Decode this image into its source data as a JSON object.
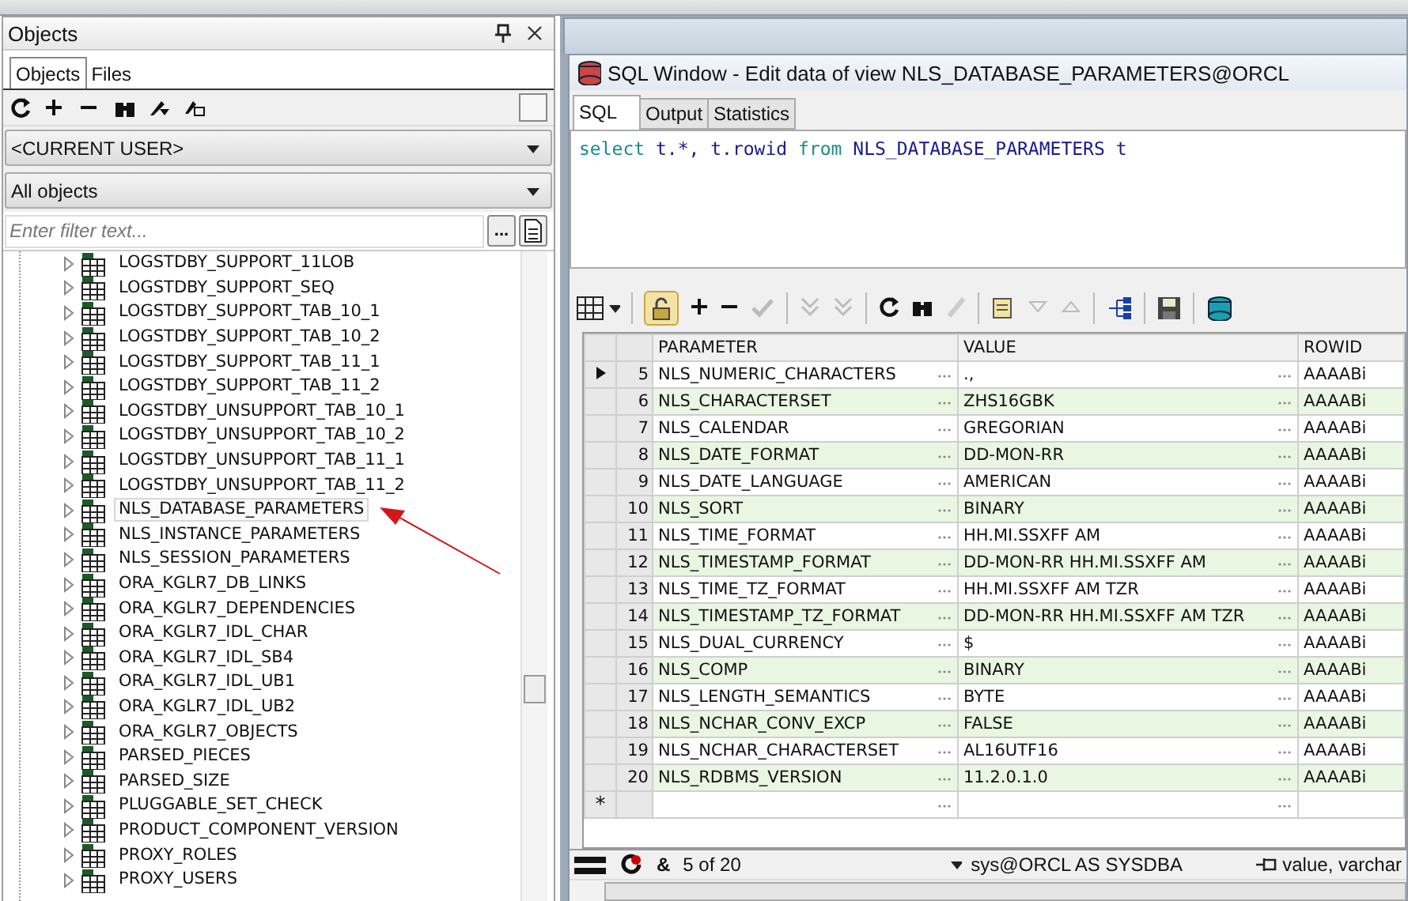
{
  "objects_panel": {
    "title": "Objects",
    "tabs": [
      {
        "label": "Objects",
        "selected": true
      },
      {
        "label": "Files",
        "selected": false
      }
    ],
    "owner_select": {
      "value": "<CURRENT USER>"
    },
    "type_select": {
      "value": "All objects"
    },
    "filter": {
      "placeholder": "Enter filter text...",
      "button": "..."
    },
    "tree": [
      {
        "label": "LOGSTDBY_SUPPORT_11LOB",
        "selected": false
      },
      {
        "label": "LOGSTDBY_SUPPORT_SEQ",
        "selected": false
      },
      {
        "label": "LOGSTDBY_SUPPORT_TAB_10_1",
        "selected": false
      },
      {
        "label": "LOGSTDBY_SUPPORT_TAB_10_2",
        "selected": false
      },
      {
        "label": "LOGSTDBY_SUPPORT_TAB_11_1",
        "selected": false
      },
      {
        "label": "LOGSTDBY_SUPPORT_TAB_11_2",
        "selected": false
      },
      {
        "label": "LOGSTDBY_UNSUPPORT_TAB_10_1",
        "selected": false
      },
      {
        "label": "LOGSTDBY_UNSUPPORT_TAB_10_2",
        "selected": false
      },
      {
        "label": "LOGSTDBY_UNSUPPORT_TAB_11_1",
        "selected": false
      },
      {
        "label": "LOGSTDBY_UNSUPPORT_TAB_11_2",
        "selected": false
      },
      {
        "label": "NLS_DATABASE_PARAMETERS",
        "selected": true
      },
      {
        "label": "NLS_INSTANCE_PARAMETERS",
        "selected": false
      },
      {
        "label": "NLS_SESSION_PARAMETERS",
        "selected": false
      },
      {
        "label": "ORA_KGLR7_DB_LINKS",
        "selected": false
      },
      {
        "label": "ORA_KGLR7_DEPENDENCIES",
        "selected": false
      },
      {
        "label": "ORA_KGLR7_IDL_CHAR",
        "selected": false
      },
      {
        "label": "ORA_KGLR7_IDL_SB4",
        "selected": false
      },
      {
        "label": "ORA_KGLR7_IDL_UB1",
        "selected": false
      },
      {
        "label": "ORA_KGLR7_IDL_UB2",
        "selected": false
      },
      {
        "label": "ORA_KGLR7_OBJECTS",
        "selected": false
      },
      {
        "label": "PARSED_PIECES",
        "selected": false
      },
      {
        "label": "PARSED_SIZE",
        "selected": false
      },
      {
        "label": "PLUGGABLE_SET_CHECK",
        "selected": false
      },
      {
        "label": "PRODUCT_COMPONENT_VERSION",
        "selected": false
      },
      {
        "label": "PROXY_ROLES",
        "selected": false
      },
      {
        "label": "PROXY_USERS",
        "selected": false
      }
    ]
  },
  "sql_window": {
    "title": "SQL Window - Edit data of view NLS_DATABASE_PARAMETERS@ORCL",
    "tabs": [
      {
        "label": "SQL",
        "selected": true
      },
      {
        "label": "Output",
        "selected": false
      },
      {
        "label": "Statistics",
        "selected": false
      }
    ],
    "query": [
      {
        "kind": "keyword",
        "text": "select"
      },
      {
        "kind": "plain",
        "text": "t.*, t.rowid"
      },
      {
        "kind": "keyword",
        "text": "from"
      },
      {
        "kind": "plain",
        "text": "NLS_DATABASE_PARAMETERS t"
      }
    ],
    "grid": {
      "columns": [
        "PARAMETER",
        "VALUE",
        "ROWID"
      ],
      "rows": [
        {
          "number": "5",
          "parameter": "NLS_NUMERIC_CHARACTERS",
          "value": ".,",
          "rowid": "AAAABi",
          "current": true
        },
        {
          "number": "6",
          "parameter": "NLS_CHARACTERSET",
          "value": "ZHS16GBK",
          "rowid": "AAAABi",
          "current": false
        },
        {
          "number": "7",
          "parameter": "NLS_CALENDAR",
          "value": "GREGORIAN",
          "rowid": "AAAABi",
          "current": false
        },
        {
          "number": "8",
          "parameter": "NLS_DATE_FORMAT",
          "value": "DD-MON-RR",
          "rowid": "AAAABi",
          "current": false
        },
        {
          "number": "9",
          "parameter": "NLS_DATE_LANGUAGE",
          "value": "AMERICAN",
          "rowid": "AAAABi",
          "current": false
        },
        {
          "number": "10",
          "parameter": "NLS_SORT",
          "value": "BINARY",
          "rowid": "AAAABi",
          "current": false
        },
        {
          "number": "11",
          "parameter": "NLS_TIME_FORMAT",
          "value": "HH.MI.SSXFF AM",
          "rowid": "AAAABi",
          "current": false
        },
        {
          "number": "12",
          "parameter": "NLS_TIMESTAMP_FORMAT",
          "value": "DD-MON-RR HH.MI.SSXFF AM",
          "rowid": "AAAABi",
          "current": false
        },
        {
          "number": "13",
          "parameter": "NLS_TIME_TZ_FORMAT",
          "value": "HH.MI.SSXFF AM TZR",
          "rowid": "AAAABi",
          "current": false
        },
        {
          "number": "14",
          "parameter": "NLS_TIMESTAMP_TZ_FORMAT",
          "value": "DD-MON-RR HH.MI.SSXFF AM TZR",
          "rowid": "AAAABi",
          "current": false
        },
        {
          "number": "15",
          "parameter": "NLS_DUAL_CURRENCY",
          "value": "$",
          "rowid": "AAAABi",
          "current": false
        },
        {
          "number": "16",
          "parameter": "NLS_COMP",
          "value": "BINARY",
          "rowid": "AAAABi",
          "current": false
        },
        {
          "number": "17",
          "parameter": "NLS_LENGTH_SEMANTICS",
          "value": "BYTE",
          "rowid": "AAAABi",
          "current": false
        },
        {
          "number": "18",
          "parameter": "NLS_NCHAR_CONV_EXCP",
          "value": "FALSE",
          "rowid": "AAAABi",
          "current": false
        },
        {
          "number": "19",
          "parameter": "NLS_NCHAR_CHARACTERSET",
          "value": "AL16UTF16",
          "rowid": "AAAABi",
          "current": false
        },
        {
          "number": "20",
          "parameter": "NLS_RDBMS_VERSION",
          "value": "11.2.0.1.0",
          "rowid": "AAAABi",
          "current": false
        }
      ],
      "new_row_mark": "*"
    },
    "status_bar": {
      "symbol": "&",
      "record": "5 of 20",
      "connection": "sys@ORCL AS SYSDBA",
      "field": "value, varchar"
    }
  }
}
